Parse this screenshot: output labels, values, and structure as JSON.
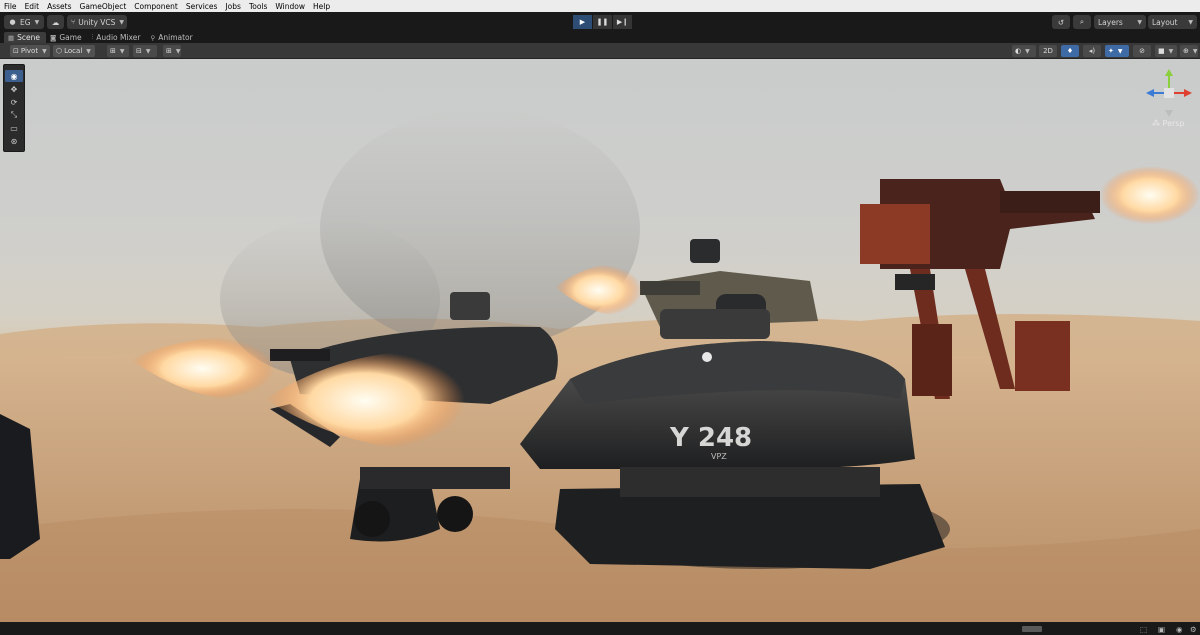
{
  "menu": [
    "File",
    "Edit",
    "Assets",
    "GameObject",
    "Component",
    "Services",
    "Jobs",
    "Tools",
    "Window",
    "Help"
  ],
  "toolbar": {
    "account_label": "EG",
    "vcs_label": "Unity VCS",
    "layers_label": "Layers",
    "layout_label": "Layout"
  },
  "tabs": [
    {
      "label": "Scene",
      "icon": "grid-icon",
      "active": true
    },
    {
      "label": "Game",
      "icon": "gamepad-icon",
      "active": false
    },
    {
      "label": "Audio Mixer",
      "icon": "audio-mixer-icon",
      "active": false
    },
    {
      "label": "Animator",
      "icon": "animator-icon",
      "active": false
    }
  ],
  "scene_toolbar": {
    "pivot_label": "Pivot",
    "space_label": "Local",
    "mode_2d_label": "2D"
  },
  "viewport": {
    "vehicle_label": "Y 248",
    "vehicle_sub_label": "VPZ",
    "camera_label": "Persp"
  },
  "tools": [
    "view-tool-icon",
    "move-tool-icon",
    "rotate-tool-icon",
    "scale-tool-icon",
    "rect-tool-icon",
    "transform-tool-icon"
  ],
  "colors": {
    "play_active": "#2d4d75",
    "gizmo_x": "#e0402f",
    "gizmo_y": "#8ccf3c",
    "gizmo_z": "#3b7bd6",
    "muzzle_flash": "#ffd9a3"
  }
}
